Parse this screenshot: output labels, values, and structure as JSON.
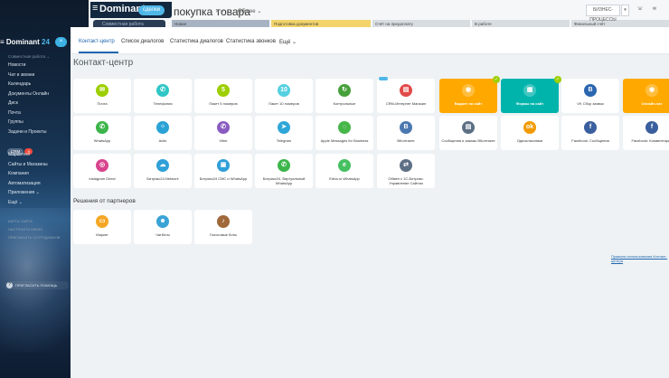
{
  "behind": {
    "brand": "Dominant",
    "brand_badge": "сделки",
    "sub_pill": "Совместная работа",
    "deal_title": "покупка товара",
    "deal_sub": "✓ ✓",
    "deal_mode": "Общее ⌄",
    "stages": [
      {
        "label": "Новая",
        "color": "#a7b3c2"
      },
      {
        "label": "Подготовка документов",
        "color": "#f2d46a"
      },
      {
        "label": "Счёт на предоплату",
        "color": "#d8dde2"
      },
      {
        "label": "В работе",
        "color": "#d8dde2"
      },
      {
        "label": "Финальный счёт",
        "color": "#d8dde2"
      }
    ],
    "btn_main": "БИЗНЕС-ПРОЦЕССЫ",
    "btn_more": "▾",
    "btn_phone": "☏",
    "btn_mail": "✉"
  },
  "sidebar": {
    "brand": "Dominant",
    "brand_num": "24",
    "close": "×",
    "sub": "Совместная работа ⌄",
    "items": [
      {
        "label": "Новости"
      },
      {
        "label": "Чат и звонки"
      },
      {
        "label": "Календарь"
      },
      {
        "label": "Документы Онлайн"
      },
      {
        "label": "Диск"
      },
      {
        "label": "Почта"
      },
      {
        "label": "Группы"
      },
      {
        "label": "Задачи и Проекты"
      }
    ],
    "crm": {
      "label": "CRM",
      "badge": "9"
    },
    "items2": [
      {
        "label": "Маркетинг"
      },
      {
        "label": "Сайты и Магазины"
      },
      {
        "label": "Компания"
      },
      {
        "label": "Автоматизация"
      },
      {
        "label": "Приложения ⌄"
      },
      {
        "label": "Ещё ⌄"
      }
    ],
    "small": [
      {
        "label": "КАРТА САЙТА"
      },
      {
        "label": "НАСТРОИТЬ МЕНЮ"
      },
      {
        "label": "ПРИГЛАСИТЬ СОТРУДНИКОВ"
      }
    ],
    "invite": "ПРИГЛАСИТЬ ПОМОЩЬ"
  },
  "main": {
    "tabs": [
      {
        "label": "Контакт-центр"
      },
      {
        "label": "Список диалогов"
      },
      {
        "label": "Статистика диалогов"
      },
      {
        "label": "Статистика звонков"
      },
      {
        "label": "Ещё ⌄"
      }
    ],
    "page_title": "Контакт-центр",
    "partners_title": "Решения от партнеров",
    "footer_link": "Правила использования Контакт-центра",
    "tiles_row1": [
      {
        "label": "Почта",
        "icon": "mail-icon",
        "glyph": "✉",
        "color": "#9dcf00"
      },
      {
        "label": "Телефония",
        "icon": "phone-icon",
        "glyph": "✆",
        "color": "#2fc6c6"
      },
      {
        "label": "Пакет 5 номеров",
        "icon": "sim-icon",
        "glyph": "5",
        "color": "#9dcf00"
      },
      {
        "label": "Пакет 10 номеров",
        "icon": "sim-icon",
        "glyph": "10",
        "color": "#55d0e0"
      },
      {
        "label": "Контрольные",
        "icon": "refresh-icon",
        "glyph": "↻",
        "color": "#47a13a"
      },
      {
        "label": "CRM-Интернет Магазин",
        "icon": "crm-icon",
        "glyph": "▤",
        "color": "#e24a4a"
      },
      {
        "label": "Виджет на сайт",
        "icon": "widget-icon",
        "glyph": "◉",
        "color": "#ffa900",
        "colored": true
      },
      {
        "label": "Формы на сайт",
        "icon": "form-icon",
        "glyph": "▦",
        "color": "#00b4ac",
        "colored": true
      },
      {
        "label": "VK Сбор заявок",
        "icon": "vk-icon",
        "glyph": "В",
        "color": "#2b66b0"
      },
      {
        "label": "Онлайн-чат",
        "icon": "chat-icon",
        "glyph": "◉",
        "color": "#ffa900",
        "colored": true
      }
    ],
    "tiles_row2": [
      {
        "label": "WhatsApp",
        "icon": "whatsapp-icon",
        "glyph": "✆",
        "color": "#3cb54a"
      },
      {
        "label": "Avito",
        "icon": "avito-icon",
        "glyph": "⁘",
        "color": "#2aa2d6"
      },
      {
        "label": "Viber",
        "icon": "viber-icon",
        "glyph": "✆",
        "color": "#8a5cc2"
      },
      {
        "label": "Telegram",
        "icon": "telegram-icon",
        "glyph": "➤",
        "color": "#2fa6d8"
      },
      {
        "label": "Apple Messages for Business",
        "icon": "apple-messages-icon",
        "glyph": "◌",
        "color": "#46b649"
      },
      {
        "label": "ВКонтакте",
        "icon": "vk-icon",
        "glyph": "В",
        "color": "#4b78b0"
      },
      {
        "label": "Сообщения и заказы ВКонтакте",
        "icon": "vk-orders-icon",
        "glyph": "▤",
        "color": "#5d6f85"
      },
      {
        "label": "Одноклассники",
        "icon": "ok-icon",
        "glyph": "ok",
        "color": "#f29a00"
      },
      {
        "label": "Facebook: Сообщения",
        "icon": "facebook-icon",
        "glyph": "f",
        "color": "#3a5f9e"
      },
      {
        "label": "Facebook: Комментарии",
        "icon": "facebook-comments-icon",
        "glyph": "f",
        "color": "#3a5f9e"
      }
    ],
    "tiles_row3": [
      {
        "label": "Instagram Direct",
        "icon": "instagram-icon",
        "glyph": "◎",
        "color": "#d7448d"
      },
      {
        "label": "Битрикс24.Network",
        "icon": "cloud-icon",
        "glyph": "☁",
        "color": "#2fa0d8"
      },
      {
        "label": "Битрикс24 СМС и WhatsApp",
        "icon": "sms-icon",
        "glyph": "▣",
        "color": "#2fa0d8"
      },
      {
        "label": "Битрикс24. Виртуальный WhatsApp",
        "icon": "whatsapp-icon",
        "glyph": "✆",
        "color": "#3cb54a"
      },
      {
        "label": "Edna.ru WhatsApp",
        "icon": "edna-icon",
        "glyph": "e",
        "color": "#46c060"
      },
      {
        "label": "Обмен с 1С-Битрикс: Управление Сайтом",
        "icon": "exchange-icon",
        "glyph": "⇄",
        "color": "#5d6f85"
      }
    ],
    "tiles_partners": [
      {
        "label": "Маркет",
        "icon": "market-icon",
        "glyph": "▭",
        "color": "#f5a623"
      },
      {
        "label": "Чатботы",
        "icon": "chatbot-icon",
        "glyph": "☻",
        "color": "#3aa3d6"
      },
      {
        "label": "Голосовые боты",
        "icon": "voicebot-icon",
        "glyph": "♪",
        "color": "#a0693a"
      }
    ]
  }
}
